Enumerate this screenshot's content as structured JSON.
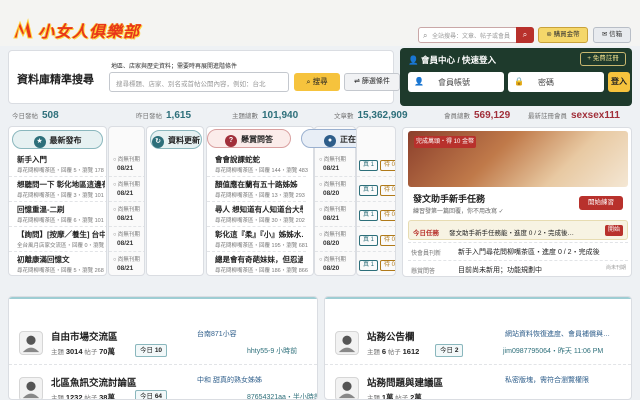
{
  "header": {
    "logo_text": "小女人俱樂部",
    "search_placeholder": "全站搜尋：文章、帖子或會員",
    "buy_coins_label": "購買金幣",
    "mail_label": "信箱"
  },
  "search": {
    "title": "資料庫精準搜尋",
    "hint": "地區、店家與歷史資料；需要時再展開進階條件",
    "placeholder": "搜尋標題、店家、別名或首帖公開內容，例如：台北",
    "search_button": "搜尋",
    "advanced_button": "篩選條件"
  },
  "member": {
    "title": "會員中心 / 快速登入",
    "free_register": "免費註冊",
    "account_label": "會員帳號",
    "password_label": "密碼",
    "login_button": "登入"
  },
  "stats": [
    {
      "label": "今日發帖",
      "value": "508",
      "accent": false
    },
    {
      "label": "昨日發帖",
      "value": "1,615",
      "accent": false
    },
    {
      "label": "主題總數",
      "value": "101,940",
      "accent": false
    },
    {
      "label": "文章數",
      "value": "15,362,909",
      "accent": false
    },
    {
      "label": "會員總數",
      "value": "569,129",
      "accent": true
    },
    {
      "label": "最新註冊會員",
      "value": "sexsex111",
      "accent": true
    }
  ],
  "columns": [
    {
      "title": "最新發布",
      "color": "#2d6f7a",
      "items": [
        {
          "title": "新手入門",
          "meta": "尋花問柳嘴茶區・回覆 5・瀏覽 178",
          "author": "尚無刊期",
          "date": "08/21"
        },
        {
          "title": "想聽問一下 彰化地區這邊有…",
          "meta": "尋花問柳嘴茶區・回覆 3・瀏覽 101",
          "author": "尚無刊期",
          "date": "08/21"
        },
        {
          "title": "回憶重溫-二刷",
          "meta": "尋花問柳嘴茶區・回覆 6・瀏覽 101",
          "author": "尚無刊期",
          "date": "08/21"
        },
        {
          "title": "【詢問】[按摩／養生] 台中 好…",
          "meta": "全台風月店家交流區・回覆 0・瀏覽 56",
          "author": "尚無刊期",
          "date": "08/21"
        },
        {
          "title": "初離康滿回憶文",
          "meta": "尋花問柳嘴茶區・回覆 5・瀏覽 268",
          "author": "尚無刊期",
          "date": "08/21"
        }
      ]
    },
    {
      "title": "資料更新",
      "color": "#2d6f7a",
      "items": [
        {
          "title": "會會說課蛇蛇",
          "meta": "尋花問柳嘴茶區・回覆 144・瀏覽 483",
          "author": "尚無刊期",
          "date": "08/21"
        },
        {
          "title": "顏值應在蘭有五十路姊姊",
          "meta": "尋花問柳嘴茶區・回覆 13・瀏覽 293",
          "author": "尚無刊期",
          "date": "08/20"
        },
        {
          "title": "尋人 想知道有人知道台大學…",
          "meta": "尋花問柳嘴茶區・回覆 30・瀏覽 202",
          "author": "尚無刊期",
          "date": "08/21"
        },
        {
          "title": "彰化這『柔』『小』姊姊水…",
          "meta": "尋花問柳嘴茶區・回覆 195・瀏覽 681",
          "author": "尚無刊期",
          "date": "08/20"
        },
        {
          "title": "總是會有奇葩妹妹，但忍過…",
          "meta": "尋花問柳嘴茶區・回覆 186・瀏覽 866",
          "author": "尚無刊期",
          "date": "08/20"
        }
      ]
    },
    {
      "title": "懸賞問答",
      "color": "#a12f3a",
      "tags": [
        "真 1",
        "待 0",
        "假 0"
      ],
      "tag_colors": [
        "#2d6f7a",
        "#b07a1a",
        "#a12f3a"
      ]
    },
    {
      "title": "正在討論",
      "color": "#2d5d8a"
    }
  ],
  "promo": {
    "badge": "完成萬頭・得 10 金幣",
    "title": "發文助手新手任務",
    "desc": "練習發第一篇回覆，你不用改寫 ✓",
    "button": "開始練習",
    "task_label": "今日任務",
    "task_text": "發文助手新手任務能・進度 0 / 2・完成後…",
    "task_go": "開始",
    "lines": [
      {
        "label": "快會員刊新",
        "value": "新手入門尋花問柳嘴茶區・進度 0 / 2・完成後",
        "right": ""
      },
      {
        "label": "懸賞問答",
        "value": "目前尚未新用；功能規劃中",
        "right": "尚未刊期"
      }
    ]
  },
  "forums_left": [
    {
      "name": "自由市場交流區",
      "topics": "3014",
      "posts": "70萬",
      "today": "10",
      "last_title": "台南871小容",
      "last_user": "hhty55-9 小時前"
    },
    {
      "name": "北區魚訊交流討論區",
      "topics": "1232",
      "posts": "38萬",
      "today": "64",
      "last_title": "中和 甜真的熟女姊姊",
      "last_user": "87654321aa・半小時前"
    }
  ],
  "forums_right": [
    {
      "name": "站務公告欄",
      "topics": "6",
      "posts": "1612",
      "today": "2",
      "last_title": "網站資料恢復進度、會員補償與…",
      "last_user": "jim0987795064・昨天 11:06 PM"
    },
    {
      "name": "站務問題與建議區",
      "topics": "1萬",
      "posts": "2萬",
      "today": "",
      "last_title": "私密版塊，需符合瀏覽權限",
      "last_user": ""
    }
  ],
  "forum_labels": {
    "topics": "主題",
    "posts": "帖子",
    "today": "今日"
  }
}
